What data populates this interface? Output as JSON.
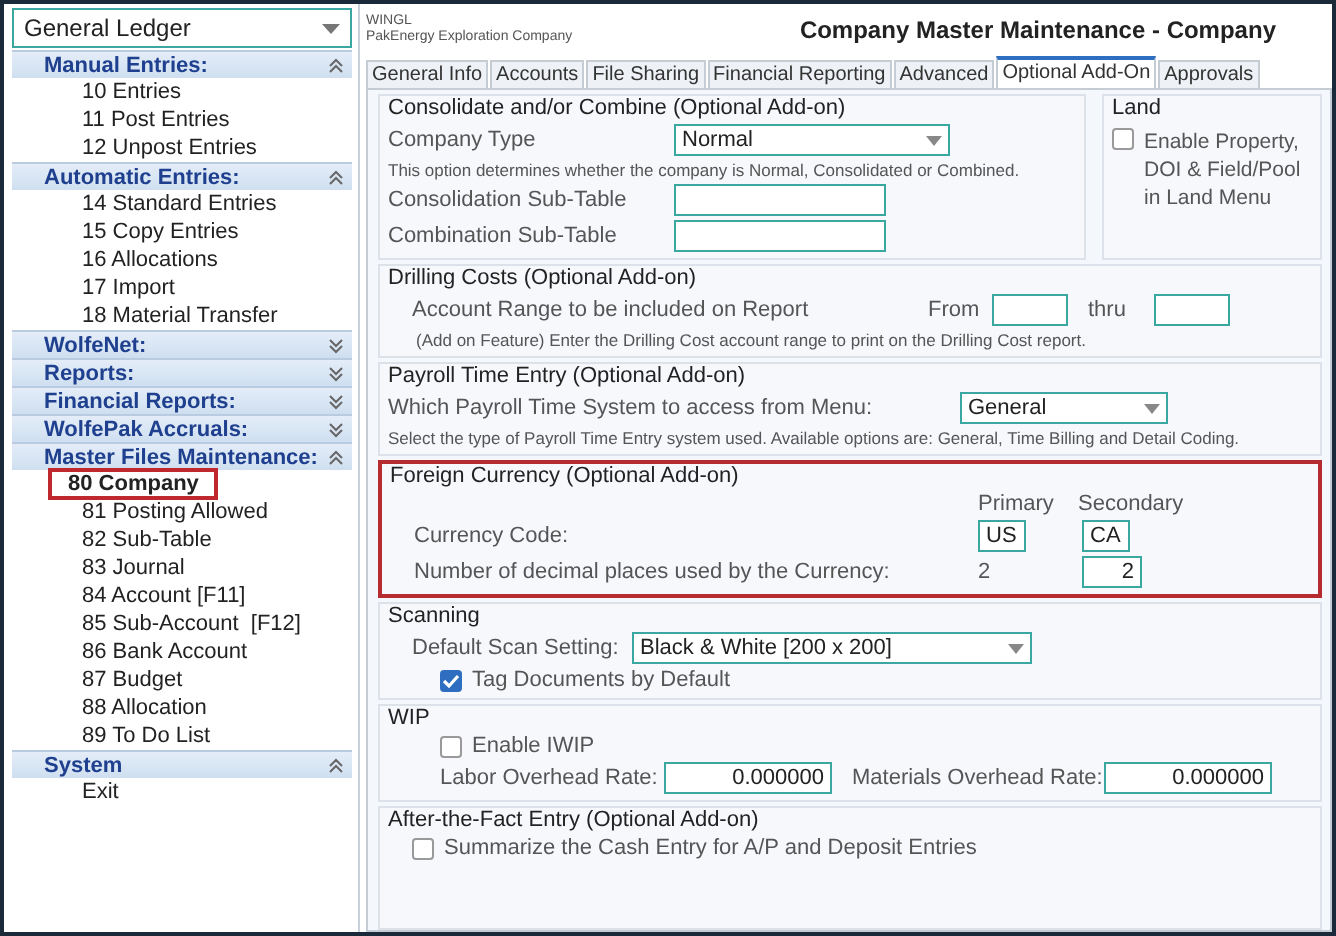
{
  "module_select": {
    "value": "General Ledger"
  },
  "sidebar": {
    "sections": [
      {
        "title": "Manual Entries:",
        "expanded": true,
        "items": [
          {
            "label": "10 Entries",
            "selected": false
          },
          {
            "label": "11 Post Entries",
            "selected": false
          },
          {
            "label": "12 Unpost Entries",
            "selected": false
          }
        ]
      },
      {
        "title": "Automatic Entries:",
        "expanded": true,
        "items": [
          {
            "label": "14 Standard Entries",
            "selected": false
          },
          {
            "label": "15 Copy Entries",
            "selected": false
          },
          {
            "label": "16 Allocations",
            "selected": false
          },
          {
            "label": "17 Import",
            "selected": false
          },
          {
            "label": "18 Material Transfer",
            "selected": false
          }
        ]
      },
      {
        "title": "WolfeNet:",
        "expanded": false
      },
      {
        "title": "Reports:",
        "expanded": false
      },
      {
        "title": "Financial Reports:",
        "expanded": false
      },
      {
        "title": "WolfePak Accruals:",
        "expanded": false
      },
      {
        "title": "Master Files Maintenance:",
        "expanded": true,
        "items": [
          {
            "label": "80 Company",
            "selected": true
          },
          {
            "label": "81 Posting Allowed",
            "selected": false
          },
          {
            "label": "82 Sub-Table",
            "selected": false
          },
          {
            "label": "83 Journal",
            "selected": false
          },
          {
            "label": "84 Account [F11]",
            "selected": false
          },
          {
            "label": "85 Sub-Account  [F12]",
            "selected": false
          },
          {
            "label": "86 Bank Account",
            "selected": false
          },
          {
            "label": "87 Budget",
            "selected": false
          },
          {
            "label": "88 Allocation",
            "selected": false
          },
          {
            "label": "89 To Do List",
            "selected": false
          }
        ]
      },
      {
        "title": "System",
        "expanded": true,
        "items": [
          {
            "label": "Exit",
            "selected": false
          }
        ]
      }
    ]
  },
  "header": {
    "app_code": "WINGL",
    "company": "PakEnergy Exploration Company",
    "title": "Company Master Maintenance - Company"
  },
  "tabs": [
    {
      "label": "General Info",
      "selected": false
    },
    {
      "label": "Accounts",
      "selected": false
    },
    {
      "label": "File Sharing",
      "selected": false
    },
    {
      "label": "Financial Reporting",
      "selected": false
    },
    {
      "label": "Advanced",
      "selected": false
    },
    {
      "label": "Optional Add-On",
      "selected": true
    },
    {
      "label": "Approvals",
      "selected": false
    }
  ],
  "consolidate": {
    "title": "Consolidate and/or Combine (Optional Add-on)",
    "company_type_label": "Company Type",
    "company_type": "Normal",
    "note": "This option determines whether the company is Normal, Consolidated or Combined.",
    "consolidation_label": "Consolidation Sub-Table",
    "combination_label": "Combination Sub-Table"
  },
  "land": {
    "title": "Land",
    "label": "Enable Property, DOI & Field/Pool in Land Menu",
    "checked": false
  },
  "drilling_costs": {
    "title": "Drilling Costs (Optional Add-on)",
    "label": "Account Range to be included on Report",
    "from_label": "From",
    "thru_label": "thru",
    "note": "(Add on Feature) Enter the Drilling Cost account range to print on the Drilling Cost report."
  },
  "payroll": {
    "title": "Payroll Time Entry (Optional Add-on)",
    "label": "Which Payroll Time System to access from Menu:",
    "value": "General",
    "note": "Select the type of Payroll Time Entry system used.  Available options are: General, Time Billing and Detail Coding."
  },
  "foreign_currency": {
    "title": "Foreign Currency (Optional Add-on)",
    "highlighted": true,
    "primary_header": "Primary",
    "secondary_header": "Secondary",
    "code_label": "Currency Code:",
    "primary_code": "US",
    "secondary_code": "CA",
    "decimals_label": "Number of decimal places used by the Currency:",
    "primary_decimals": "2",
    "secondary_decimals": "2"
  },
  "scanning": {
    "title": "Scanning",
    "label": "Default Scan Setting:",
    "value": "Black & White [200 x 200]",
    "tag_label": "Tag Documents by Default",
    "tag_checked": true
  },
  "wip": {
    "title": "WIP",
    "enable_label": "Enable IWIP",
    "enable_checked": false,
    "labor_label": "Labor Overhead Rate:",
    "labor_value": "0.000000",
    "materials_label": "Materials Overhead Rate:",
    "materials_value": "0.000000"
  },
  "after_the_fact": {
    "title": "After-the-Fact Entry (Optional Add-on)",
    "label": "Summarize the Cash Entry for A/P and Deposit Entries",
    "checked": false
  }
}
